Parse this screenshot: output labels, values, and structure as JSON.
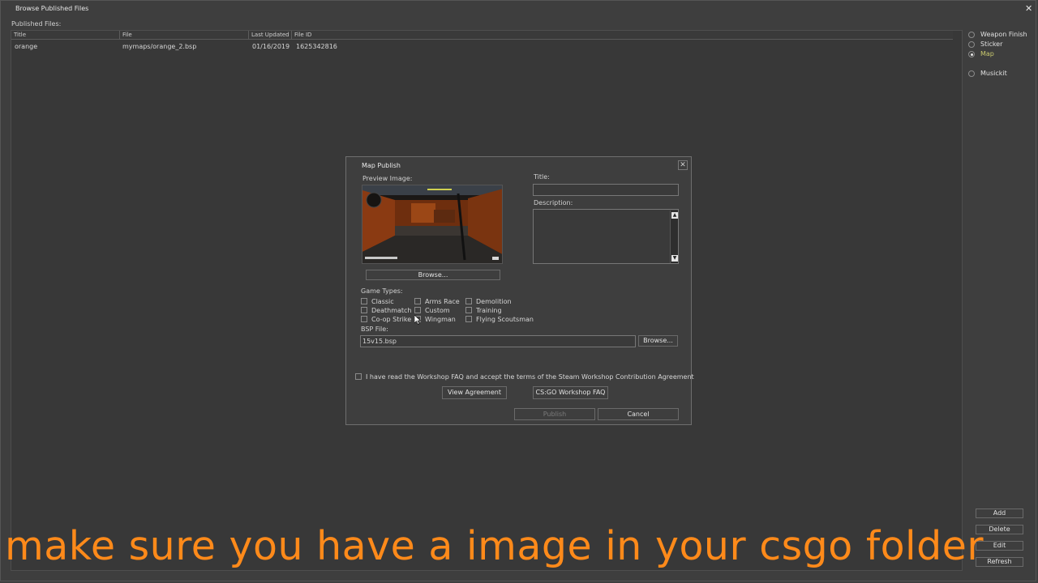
{
  "window": {
    "title": "Browse Published Files",
    "close_glyph": "✕"
  },
  "published_label": "Published Files:",
  "table": {
    "columns": [
      "Title",
      "File",
      "Last Updated",
      "File ID"
    ],
    "rows": [
      {
        "title": "orange",
        "file": "mymaps/orange_2.bsp",
        "updated": "01/16/2019",
        "id": "1625342816"
      }
    ]
  },
  "types": [
    {
      "label": "Weapon Finish",
      "selected": false
    },
    {
      "label": "Sticker",
      "selected": false
    },
    {
      "label": "Map",
      "selected": true
    },
    {
      "label": "Musickit",
      "selected": false
    }
  ],
  "side_buttons": {
    "add": "Add",
    "delete": "Delete",
    "edit": "Edit",
    "refresh": "Refresh"
  },
  "dialog": {
    "title": "Map Publish",
    "close_glyph": "✕",
    "preview_label": "Preview Image:",
    "browse_image": "Browse...",
    "title_label": "Title:",
    "title_value": "",
    "description_label": "Description:",
    "description_value": "",
    "game_types_label": "Game Types:",
    "game_types": [
      [
        "Classic",
        "Deathmatch",
        "Co-op Strike"
      ],
      [
        "Arms Race",
        "Custom",
        "Wingman"
      ],
      [
        "Demolition",
        "Training",
        "Flying Scoutsman"
      ]
    ],
    "bsp_label": "BSP File:",
    "bsp_value": "15v15.bsp",
    "browse_bsp": "Browse...",
    "agreement_text": "I have read the Workshop FAQ and accept the terms of the Steam Workshop Contribution Agreement",
    "view_agreement": "View Agreement",
    "faq": "CS:GO Workshop FAQ",
    "publish": "Publish",
    "cancel": "Cancel"
  },
  "caption": "make sure you have a image in your csgo folder",
  "colors": {
    "background": "#3e3e3e",
    "caption": "#ff8a1a",
    "selected_radio_label": "#c8c86e"
  }
}
